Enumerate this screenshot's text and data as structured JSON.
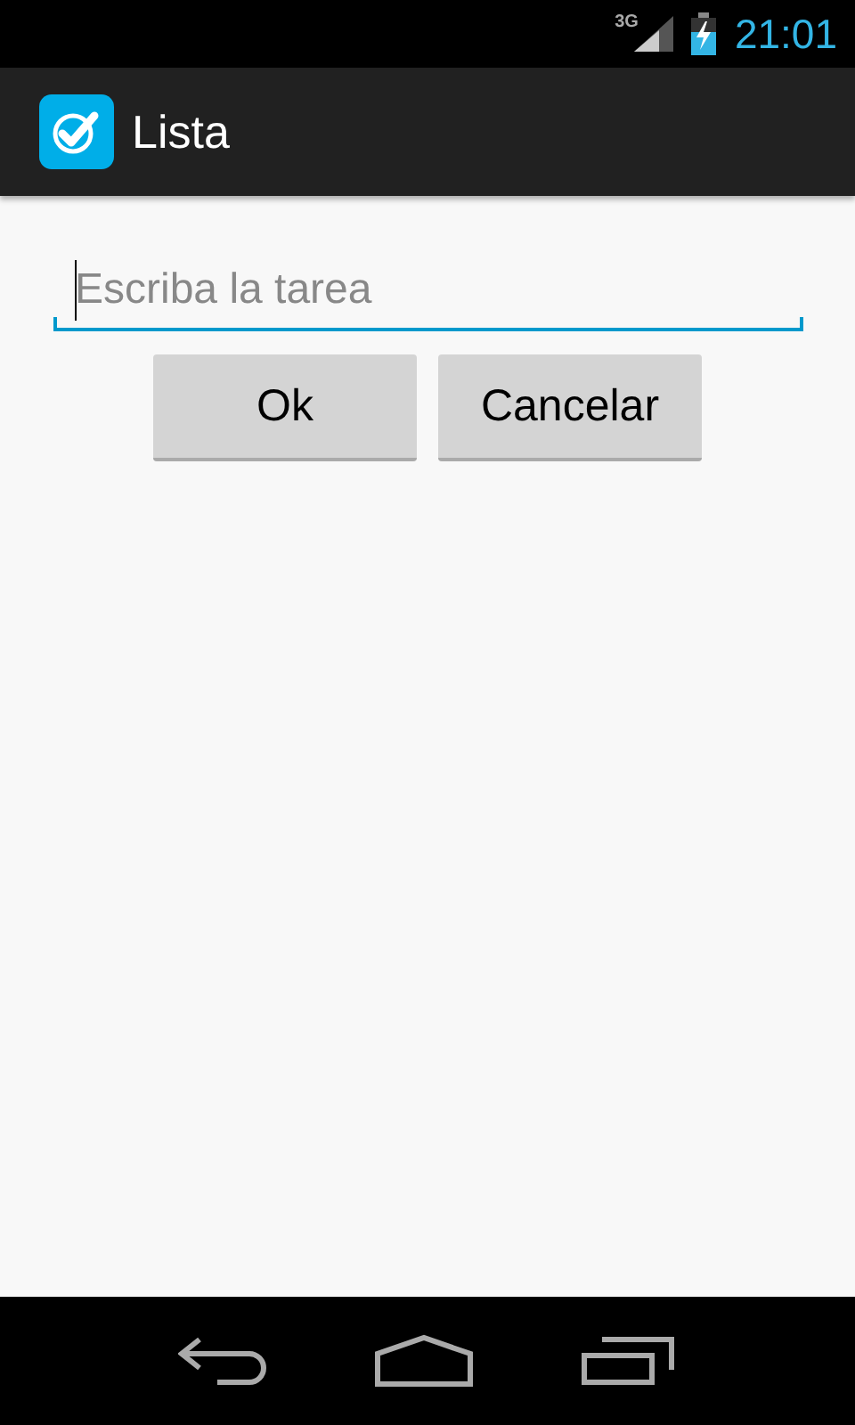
{
  "status_bar": {
    "network": "3G",
    "time": "21:01"
  },
  "action_bar": {
    "title": "Lista"
  },
  "task_field": {
    "placeholder": "Escriba la tarea",
    "focused": true
  },
  "buttons": [
    {
      "label": "Ok"
    },
    {
      "label": "Cancelar"
    }
  ]
}
